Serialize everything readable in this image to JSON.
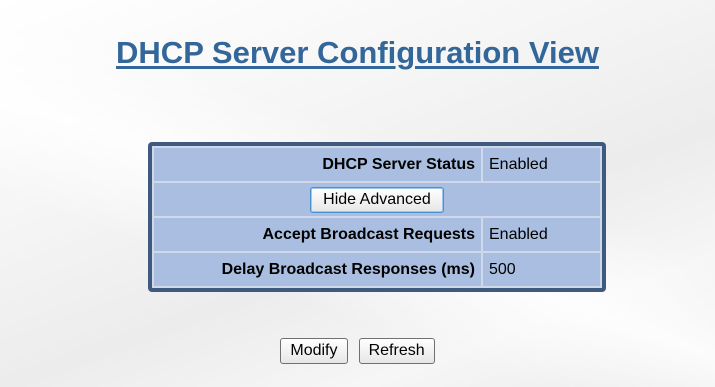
{
  "page": {
    "title": "DHCP Server Configuration View"
  },
  "config": {
    "rows": [
      {
        "label": "DHCP Server Status",
        "value": "Enabled"
      },
      {
        "label": "Accept Broadcast Requests",
        "value": "Enabled"
      },
      {
        "label": "Delay Broadcast Responses (ms)",
        "value": "500"
      }
    ],
    "advanced_button": "Hide Advanced"
  },
  "actions": {
    "modify": "Modify",
    "refresh": "Refresh"
  },
  "colors": {
    "title": "#336699",
    "panel_border": "#3f5a7f",
    "cell_bg": "#a9bee0"
  }
}
